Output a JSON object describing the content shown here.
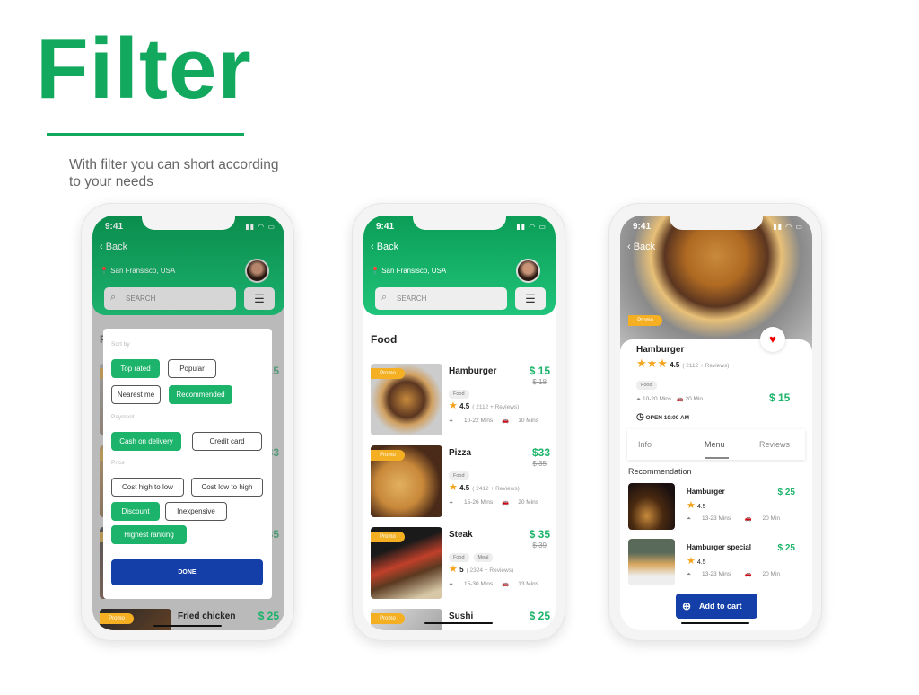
{
  "hero": {
    "title": "Filter",
    "subtitle": "With filter you can short according to your needs"
  },
  "colors": {
    "accent": "#1cb36a",
    "header": "#0b9d56",
    "primary_button": "#143fa8",
    "promo": "#f4b022"
  },
  "status": {
    "time": "9:41",
    "icons": "▮▮ ◠ ▭"
  },
  "header": {
    "back": "‹ Back",
    "location": "San Fransisco, USA",
    "search_placeholder": "SEARCH",
    "filter_icon": "sliders-icon"
  },
  "list": {
    "heading": "Food",
    "promo": "Promo",
    "items": [
      {
        "name": "Hamburger",
        "price": "$ 15",
        "old": "$ 18",
        "tags": [
          "Food"
        ],
        "rating": "4.5",
        "reviews": "( 2112 + Reviews)",
        "prep": "10-22 Mins",
        "delivery": "10 Mins"
      },
      {
        "name": "Pizza",
        "price": "$33",
        "old": "$ 35",
        "tags": [
          "Food"
        ],
        "rating": "4.5",
        "reviews": "( 2412 + Reviews)",
        "prep": "15-26 Mins",
        "delivery": "20 Mins"
      },
      {
        "name": "Steak",
        "price": "$ 35",
        "old": "$ 39",
        "tags": [
          "Food",
          "Meal"
        ],
        "rating": "5",
        "reviews": "( 2324 + Reviews)",
        "prep": "15-30 Mins",
        "delivery": "13 Mins"
      },
      {
        "name": "Sushi",
        "price": "$ 25"
      }
    ],
    "behind_item": {
      "name": "Fried chicken",
      "price": "$ 25"
    }
  },
  "filter": {
    "sort_label": "Sort by",
    "sort": [
      {
        "label": "Top rated",
        "on": true
      },
      {
        "label": "Popular",
        "on": false
      },
      {
        "label": "Nearest me",
        "on": false
      },
      {
        "label": "Recommended",
        "on": true
      }
    ],
    "payment_label": "Payment",
    "payment": [
      {
        "label": "Cash on delivery",
        "on": true
      },
      {
        "label": "Credit card",
        "on": false
      }
    ],
    "price_label": "Price",
    "price": [
      {
        "label": "Cost high to low",
        "on": false
      },
      {
        "label": "Cost low to high",
        "on": false
      },
      {
        "label": "Discount",
        "on": true
      },
      {
        "label": "Inexpensive",
        "on": false
      },
      {
        "label": "Highest ranking",
        "on": true
      }
    ],
    "done": "DONE"
  },
  "detail": {
    "promo": "Promo",
    "name": "Hamburger",
    "stars": 3,
    "rating": "4.5",
    "reviews": "( 2112 + Reviews)",
    "tag": "Food",
    "prep": "10-20 Mins",
    "delivery": "20 Min",
    "price": "$ 15",
    "open": "OPEN 10:00 AM",
    "tabs": [
      "Info",
      "Menu",
      "Reviews"
    ],
    "active_tab": "Menu",
    "rec_heading": "Recommendation",
    "recs": [
      {
        "name": "Hamburger",
        "price": "$ 25",
        "rating": "4.5",
        "prep": "13-23 Mins",
        "delivery": "20 Min"
      },
      {
        "name": "Hamburger special",
        "price": "$ 25",
        "rating": "4.5",
        "prep": "13-23 Mins",
        "delivery": "20 Min"
      }
    ],
    "add_to_cart": "Add to cart"
  }
}
